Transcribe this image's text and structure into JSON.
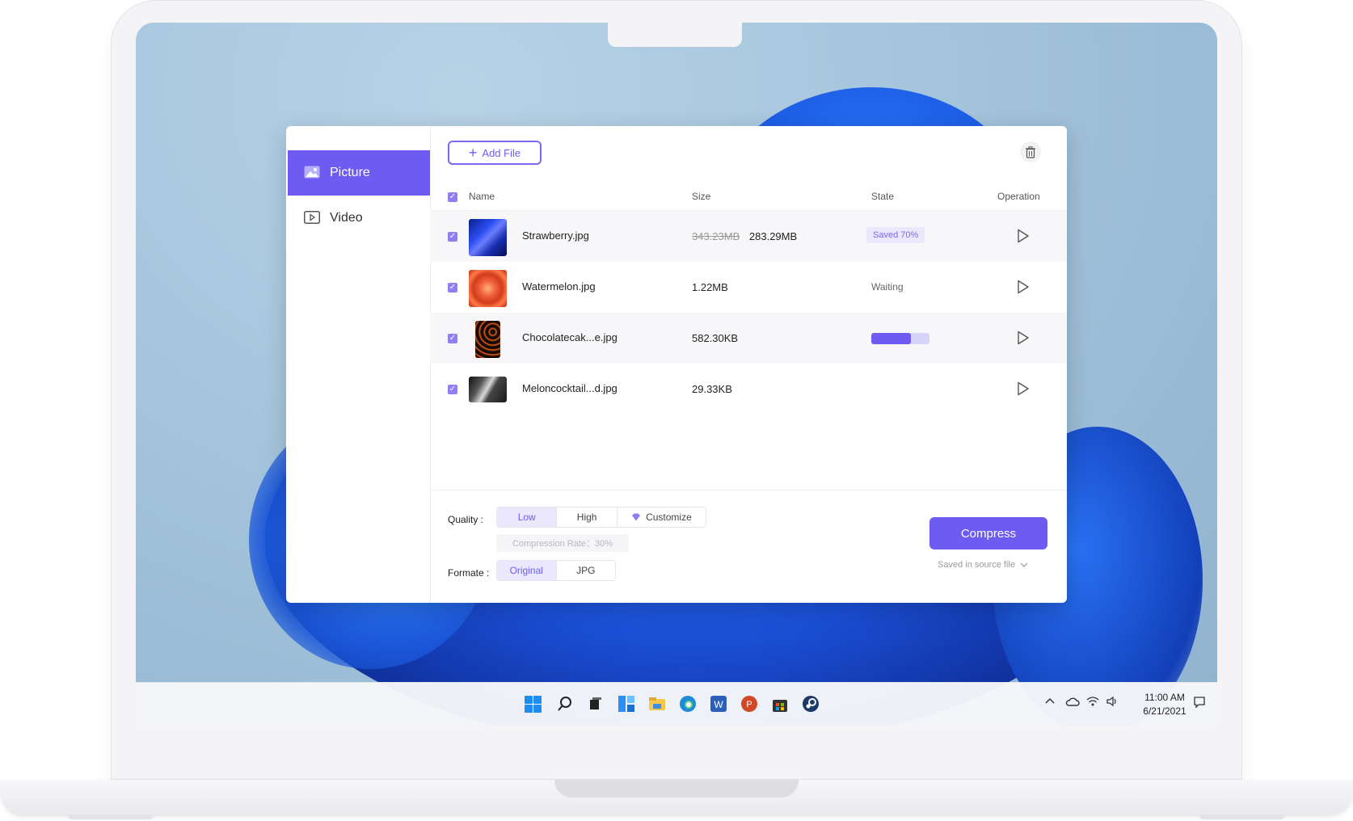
{
  "sidebar": {
    "items": [
      {
        "label": "Picture",
        "icon": "image-icon",
        "active": true
      },
      {
        "label": "Video",
        "icon": "video-icon",
        "active": false
      }
    ]
  },
  "toolbar": {
    "add_file_label": "Add File",
    "delete_icon": "trash-icon"
  },
  "table": {
    "headers": {
      "name": "Name",
      "size": "Size",
      "state": "State",
      "operation": "Operation"
    },
    "rows": [
      {
        "name": "Strawberry.jpg",
        "old_size": "343.23MB",
        "size": "283.29MB",
        "state": "Saved 70%",
        "checked": true
      },
      {
        "name": "Watermelon.jpg",
        "size": "1.22MB",
        "state": "Waiting",
        "checked": true
      },
      {
        "name": "Chocolatecak...e.jpg",
        "size": "582.30KB",
        "progress": 0.68,
        "checked": true
      },
      {
        "name": "Meloncocktail...d.jpg",
        "size": "29.33KB",
        "state": "",
        "checked": true
      }
    ]
  },
  "settings": {
    "quality_label": "Quality :",
    "quality_options": [
      "Low",
      "High",
      "Customize"
    ],
    "quality_selected": "Low",
    "compression_rate": "Compression Rate：30%",
    "format_label": "Formate :",
    "format_options": [
      "Original",
      "JPG"
    ],
    "format_selected": "Original"
  },
  "actions": {
    "compress_label": "Compress",
    "save_location": "Saved in source file"
  },
  "taskbar": {
    "time": "11:00 AM",
    "date": "6/21/2021"
  },
  "colors": {
    "accent": "#6e5bf2",
    "accent_light": "#ebe8fd"
  }
}
